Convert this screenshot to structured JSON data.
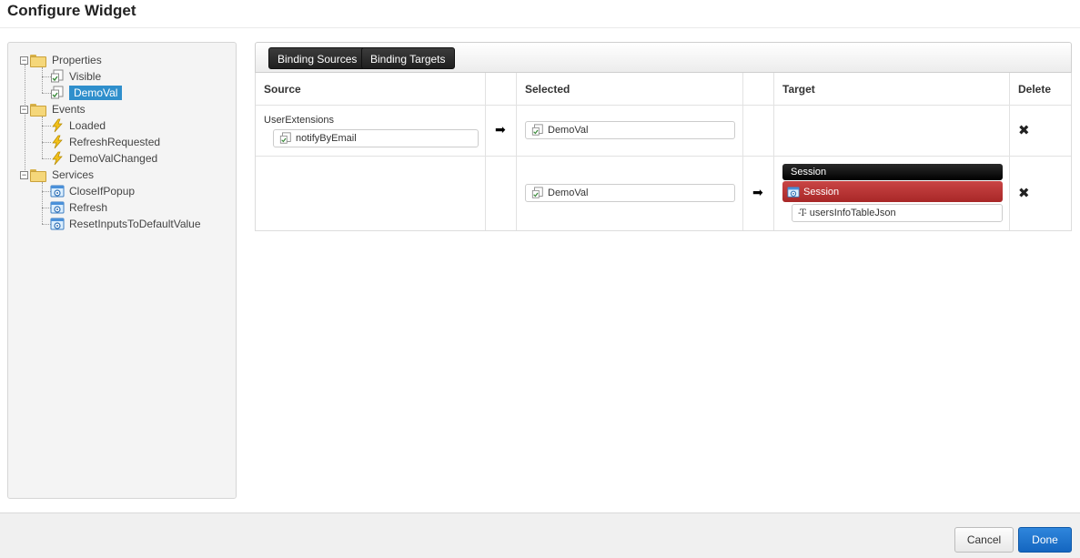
{
  "dialog": {
    "title": "Configure Widget"
  },
  "tree": {
    "properties": {
      "label": "Properties",
      "items": [
        "Visible",
        "DemoVal"
      ]
    },
    "events": {
      "label": "Events",
      "items": [
        "Loaded",
        "RefreshRequested",
        "DemoValChanged"
      ]
    },
    "services": {
      "label": "Services",
      "items": [
        "CloseIfPopup",
        "Refresh",
        "ResetInputsToDefaultValue"
      ]
    },
    "selected_item": "DemoVal"
  },
  "tabs": {
    "binding_sources": "Binding Sources",
    "binding_targets": "Binding Targets"
  },
  "grid": {
    "headers": {
      "source": "Source",
      "selected": "Selected",
      "target": "Target",
      "delete": "Delete"
    },
    "rows": [
      {
        "source_group": "UserExtensions",
        "source_field": "notifyByEmail",
        "arrow_1": "➡",
        "selected": "DemoVal",
        "delete": "✖"
      },
      {
        "selected": "DemoVal",
        "arrow_2": "➡",
        "target_header": "Session",
        "target_entity": "Session",
        "target_field": "usersInfoTableJson",
        "delete": "✖"
      }
    ]
  },
  "footer": {
    "cancel": "Cancel",
    "done": "Done"
  },
  "icons": {
    "folder": "folder-icon",
    "property": "property-icon",
    "event": "lightning-icon",
    "service": "service-icon",
    "arrow": "right-arrow-icon",
    "delete": "delete-x-icon",
    "string_type": "string-type-icon"
  },
  "colors": {
    "selected": "#2f8fcc",
    "done_button": "#1466c0",
    "session_red": "#b83232"
  }
}
